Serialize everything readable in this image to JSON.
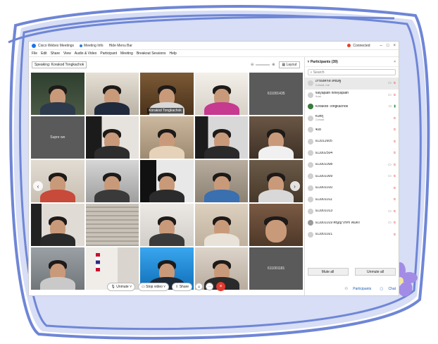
{
  "titlebar": {
    "app_name": "Cisco Webex Meetings",
    "meeting_info": "Meeting Info",
    "hide_menu": "Hide Menu Bar",
    "connection": "Connected",
    "minimize": "–",
    "restore": "□",
    "close": "×"
  },
  "menu": [
    "File",
    "Edit",
    "Share",
    "View",
    "Audio & Video",
    "Participant",
    "Meeting",
    "Breakout Sessions",
    "Help"
  ],
  "stage": {
    "speaking_label": "Speaking: Korakod Tongkachok",
    "layout_label": "Layout",
    "active_name": "Korakod Tongkachok",
    "tile_name_1": "611001435",
    "tile_name_2": "Supre we",
    "tile_name_3": "611001181"
  },
  "controls": {
    "unmute": "Unmute",
    "stop_video": "Stop video",
    "share": "Share",
    "more": "···",
    "end": "×"
  },
  "panel": {
    "title": "Participants (39)",
    "close": "×",
    "search_placeholder": "Search",
    "participants": [
      {
        "name": "เกรียงศักดิ์ สีชมพู",
        "role": "Cohost, me"
      },
      {
        "name": "naiyapath nirleyapath",
        "role": "Host"
      },
      {
        "name": "Korakod Tongkachok",
        "role": ""
      },
      {
        "name": "Kunrj",
        "role": "Cohost"
      },
      {
        "name": "408",
        "role": ""
      },
      {
        "name": "611011605",
        "role": ""
      },
      {
        "name": "611002504",
        "role": ""
      },
      {
        "name": "611001008",
        "role": ""
      },
      {
        "name": "611001009",
        "role": ""
      },
      {
        "name": "611001010",
        "role": ""
      },
      {
        "name": "611001011",
        "role": ""
      },
      {
        "name": "611001013",
        "role": ""
      },
      {
        "name": "611001019 ศิญญาภัทร สีแตง",
        "role": ""
      },
      {
        "name": "611001021",
        "role": ""
      }
    ],
    "mute_all": "Mute all",
    "unmute_all": "Unmute all",
    "participants_btn": "Participants",
    "chat_btn": "Chat"
  },
  "colors": {
    "frame_blue": "#6f86d6",
    "frame_fill": "#d7def5",
    "active_outline": "#4db3e6",
    "end_red": "#e03b2f",
    "flower": "#a38ce6"
  }
}
